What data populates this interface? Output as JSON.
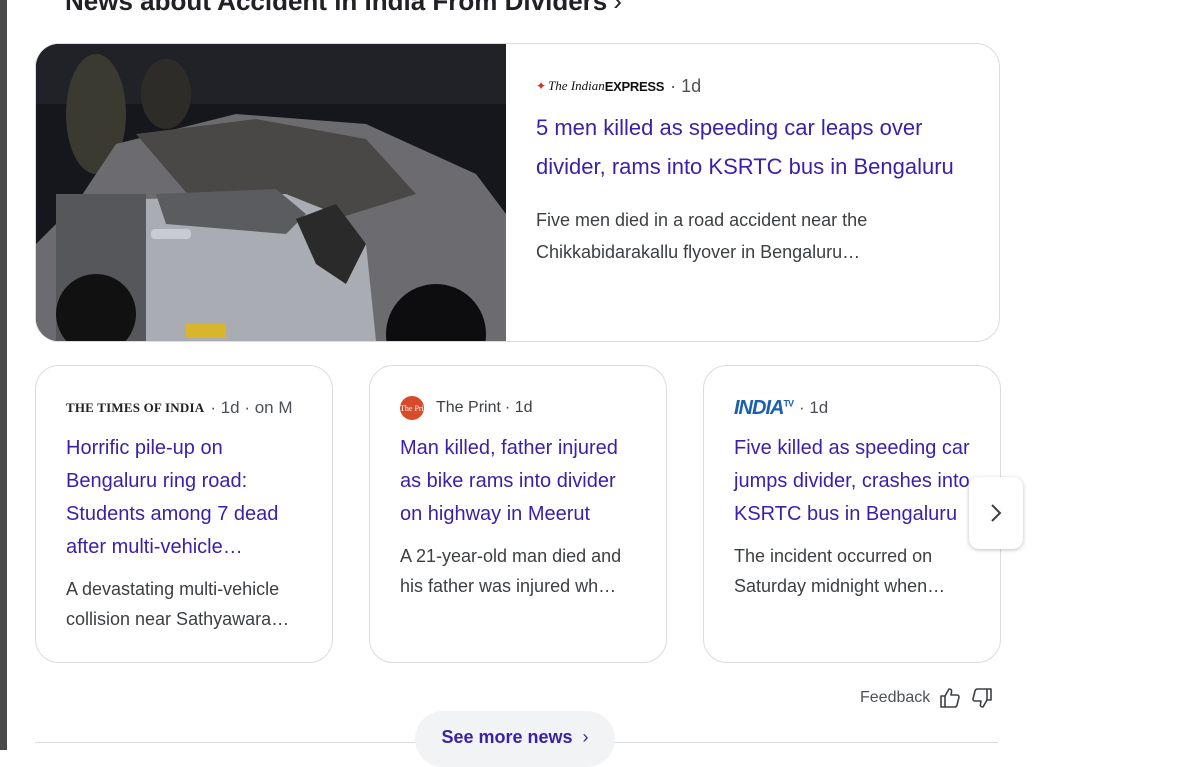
{
  "section": {
    "title": "News about Accident in India From Dividers",
    "chevron": "›"
  },
  "hero": {
    "source_logo_part1": "The Indian",
    "source_logo_part2": "EXPRESS",
    "time": "· 1d",
    "headline": "5 men killed as speeding car leaps over divider, rams into KSRTC bus in Bengaluru",
    "snippet": "Five men died in a road accident near the Chikkabidarakallu flyover in Bengaluru…"
  },
  "cards": [
    {
      "source": "THE TIMES OF INDIA",
      "time": "· 1d · on M",
      "headline": "Horrific pile-up on Bengaluru ring road: Students among 7 dead after multi-vehicle…",
      "snippet": "A devastating multi-vehicle collision near Sathyawara…"
    },
    {
      "logo_text": "The Print",
      "source": "The Print",
      "time": "· 1d",
      "headline": "Man killed, father injured as bike rams into divider on highway in Meerut",
      "snippet": "A 21-year-old man died and his father was injured wh…"
    },
    {
      "source": "INDIA",
      "source_sup": "TV",
      "time": "· 1d",
      "headline": "Five killed as speeding car jumps divider, crashes into KSRTC bus in Bengaluru",
      "snippet": "The incident occurred on Saturday midnight when…"
    }
  ],
  "feedback": {
    "label": "Feedback"
  },
  "see_more": {
    "label": "See more news"
  },
  "colors": {
    "link": "#3b1fa9",
    "border": "#dadce0",
    "text": "#3c4043"
  }
}
